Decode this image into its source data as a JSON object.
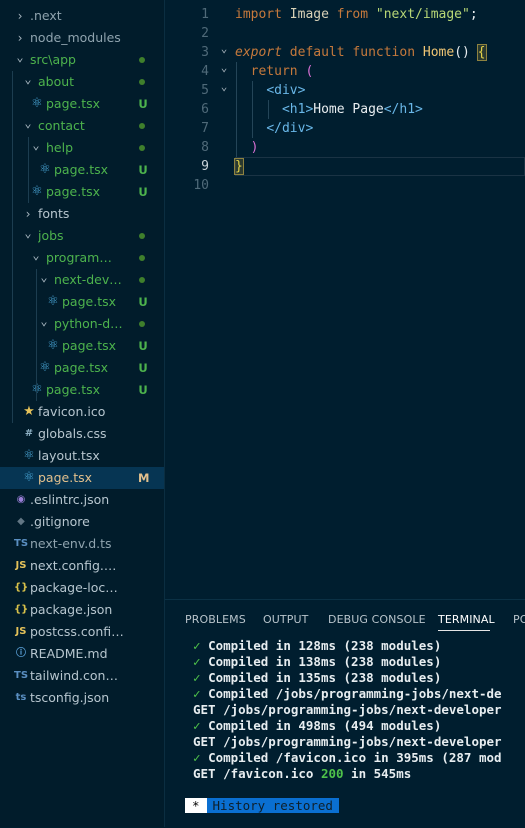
{
  "explorer": {
    "items": [
      {
        "label": ".next",
        "kind": "folder",
        "expanded": false,
        "depth": 0,
        "color": "#8fa3ae"
      },
      {
        "label": "node_modules",
        "kind": "folder",
        "expanded": false,
        "depth": 0,
        "color": "#8fa3ae"
      },
      {
        "label": "src\\app",
        "kind": "folder",
        "expanded": true,
        "depth": 0,
        "color": "#4db34d",
        "dot": true
      },
      {
        "label": "about",
        "kind": "folder",
        "expanded": true,
        "depth": 1,
        "color": "#4db34d",
        "dot": true
      },
      {
        "label": "page.tsx",
        "kind": "react",
        "depth": 2,
        "color": "#4db34d",
        "badge": "U",
        "badgeColor": "#4db34d"
      },
      {
        "label": "contact",
        "kind": "folder",
        "expanded": true,
        "depth": 1,
        "color": "#4db34d",
        "dot": true
      },
      {
        "label": "help",
        "kind": "folder",
        "expanded": true,
        "depth": 2,
        "color": "#4db34d",
        "dot": true
      },
      {
        "label": "page.tsx",
        "kind": "react",
        "depth": 3,
        "color": "#4db34d",
        "badge": "U",
        "badgeColor": "#4db34d"
      },
      {
        "label": "page.tsx",
        "kind": "react",
        "depth": 2,
        "color": "#4db34d",
        "badge": "U",
        "badgeColor": "#4db34d"
      },
      {
        "label": "fonts",
        "kind": "folder",
        "expanded": false,
        "depth": 1,
        "color": "#b7c6cf"
      },
      {
        "label": "jobs",
        "kind": "folder",
        "expanded": true,
        "depth": 1,
        "color": "#4db34d",
        "dot": true
      },
      {
        "label": "programmin...",
        "kind": "folder",
        "expanded": true,
        "depth": 2,
        "color": "#4db34d",
        "dot": true
      },
      {
        "label": "next-develo...",
        "kind": "folder",
        "expanded": true,
        "depth": 3,
        "color": "#4db34d",
        "dot": true
      },
      {
        "label": "page.tsx",
        "kind": "react",
        "depth": 4,
        "color": "#4db34d",
        "badge": "U",
        "badgeColor": "#4db34d"
      },
      {
        "label": "python-dev...",
        "kind": "folder",
        "expanded": true,
        "depth": 3,
        "color": "#4db34d",
        "dot": true
      },
      {
        "label": "page.tsx",
        "kind": "react",
        "depth": 4,
        "color": "#4db34d",
        "badge": "U",
        "badgeColor": "#4db34d"
      },
      {
        "label": "page.tsx",
        "kind": "react",
        "depth": 3,
        "color": "#4db34d",
        "badge": "U",
        "badgeColor": "#4db34d"
      },
      {
        "label": "page.tsx",
        "kind": "react",
        "depth": 2,
        "color": "#4db34d",
        "badge": "U",
        "badgeColor": "#4db34d"
      },
      {
        "label": "favicon.ico",
        "kind": "star",
        "depth": 1,
        "color": "#b7c6cf"
      },
      {
        "label": "globals.css",
        "kind": "hash",
        "depth": 1,
        "color": "#b7c6cf"
      },
      {
        "label": "layout.tsx",
        "kind": "react",
        "depth": 1,
        "color": "#b7c6cf"
      },
      {
        "label": "page.tsx",
        "kind": "react",
        "depth": 1,
        "color": "#e2c08d",
        "badge": "M",
        "badgeColor": "#e2c08d",
        "active": true
      },
      {
        "label": ".eslintrc.json",
        "kind": "eslint",
        "depth": 0,
        "color": "#b7c6cf"
      },
      {
        "label": ".gitignore",
        "kind": "git",
        "depth": 0,
        "color": "#b7c6cf"
      },
      {
        "label": "next-env.d.ts",
        "kind": "ts",
        "depth": 0,
        "color": "#8fa3ae"
      },
      {
        "label": "next.config.mjs",
        "kind": "js",
        "depth": 0,
        "color": "#b7c6cf"
      },
      {
        "label": "package-lock.json",
        "kind": "json",
        "depth": 0,
        "color": "#b7c6cf"
      },
      {
        "label": "package.json",
        "kind": "json",
        "depth": 0,
        "color": "#b7c6cf"
      },
      {
        "label": "postcss.config.mjs",
        "kind": "js",
        "depth": 0,
        "color": "#b7c6cf"
      },
      {
        "label": "README.md",
        "kind": "info",
        "depth": 0,
        "color": "#b7c6cf"
      },
      {
        "label": "tailwind.config.ts",
        "kind": "ts",
        "depth": 0,
        "color": "#b7c6cf"
      },
      {
        "label": "tsconfig.json",
        "kind": "tsconfig",
        "depth": 0,
        "color": "#b7c6cf"
      }
    ]
  },
  "editor": {
    "line_numbers": [
      "1",
      "2",
      "3",
      "4",
      "5",
      "6",
      "7",
      "8",
      "9",
      "10"
    ],
    "current_line": "9",
    "lines": [
      [
        {
          "t": "import",
          "c": "k-imp"
        },
        {
          "t": " Image ",
          "c": "k-id"
        },
        {
          "t": "from",
          "c": "k-imp"
        },
        {
          "t": " ",
          "c": "k-txt"
        },
        {
          "t": "\"next/image\"",
          "c": "k-str"
        },
        {
          "t": ";",
          "c": "k-txt"
        }
      ],
      [],
      [
        {
          "t": "export",
          "c": "k-ital"
        },
        {
          "t": " ",
          "c": "k-txt"
        },
        {
          "t": "default",
          "c": "k-imp"
        },
        {
          "t": " ",
          "c": "k-txt"
        },
        {
          "t": "function",
          "c": "k-imp"
        },
        {
          "t": " ",
          "c": "k-txt"
        },
        {
          "t": "Home",
          "c": "k-fn"
        },
        {
          "t": "() ",
          "c": "k-txt"
        },
        {
          "t": "{",
          "c": "k-brace"
        }
      ],
      [
        {
          "t": "  ",
          "c": "k-txt"
        },
        {
          "t": "return",
          "c": "k-imp"
        },
        {
          "t": " ",
          "c": "k-txt"
        },
        {
          "t": "(",
          "c": "k-paren"
        }
      ],
      [
        {
          "t": "    ",
          "c": "k-txt"
        },
        {
          "t": "<div>",
          "c": "k-tag"
        }
      ],
      [
        {
          "t": "      ",
          "c": "k-txt"
        },
        {
          "t": "<h1>",
          "c": "k-tag"
        },
        {
          "t": "Home Page",
          "c": "k-txt"
        },
        {
          "t": "</h1>",
          "c": "k-tag"
        }
      ],
      [
        {
          "t": "    ",
          "c": "k-txt"
        },
        {
          "t": "</div>",
          "c": "k-tag"
        }
      ],
      [
        {
          "t": "  ",
          "c": "k-txt"
        },
        {
          "t": ")",
          "c": "k-paren"
        }
      ],
      [
        {
          "t": "}",
          "c": "k-brace"
        }
      ],
      []
    ],
    "fold_markers": {
      "3": "⌄",
      "4": "⌄",
      "5": "⌄"
    }
  },
  "panel": {
    "tabs": [
      "PROBLEMS",
      "OUTPUT",
      "DEBUG CONSOLE",
      "TERMINAL",
      "PO"
    ],
    "active_tab": "TERMINAL",
    "terminal_lines": [
      [
        {
          "t": "✓ ",
          "c": "t-check"
        },
        {
          "t": "Compiled in 128ms (238 modules)",
          "c": ""
        }
      ],
      [
        {
          "t": "✓ ",
          "c": "t-check"
        },
        {
          "t": "Compiled in 138ms (238 modules)",
          "c": ""
        }
      ],
      [
        {
          "t": "✓ ",
          "c": "t-check"
        },
        {
          "t": "Compiled in 135ms (238 modules)",
          "c": ""
        }
      ],
      [
        {
          "t": "✓ ",
          "c": "t-check"
        },
        {
          "t": "Compiled /jobs/programming-jobs/next-de",
          "c": ""
        }
      ],
      [
        {
          "t": "GET /jobs/programming-jobs/next-developer",
          "c": ""
        }
      ],
      [
        {
          "t": "✓ ",
          "c": "t-check"
        },
        {
          "t": "Compiled in 498ms (494 modules)",
          "c": ""
        }
      ],
      [
        {
          "t": "GET /jobs/programming-jobs/next-developer",
          "c": ""
        }
      ],
      [
        {
          "t": "✓ ",
          "c": "t-check"
        },
        {
          "t": "Compiled /favicon.ico in 395ms (287 mod",
          "c": ""
        }
      ],
      [
        {
          "t": "GET /favicon.ico ",
          "c": ""
        },
        {
          "t": "200",
          "c": "t-green"
        },
        {
          "t": " in 545ms",
          "c": ""
        }
      ]
    ],
    "history_marker": "*",
    "history_text": "History restored"
  },
  "colors": {
    "background": "#001e2f",
    "sidebar": "#011c2b",
    "untracked": "#4db34d",
    "modified": "#e2c08d",
    "history_badge": "#0a6fd1"
  }
}
